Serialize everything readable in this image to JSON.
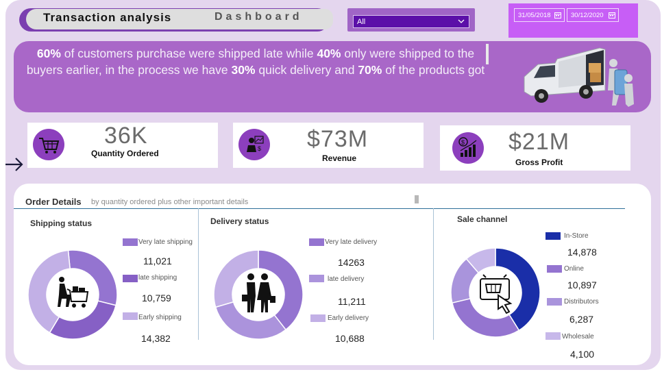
{
  "header": {
    "title_left": "Transaction analysis",
    "title_right": "Dashboard",
    "filter_value": "All",
    "date_start": "31/05/2018",
    "date_end": "30/12/2020"
  },
  "banner": {
    "p1": "60%",
    "t1": " of customers purchase were shipped late while ",
    "p2": "40%",
    "t2": " only were shipped to the buyers earlier, in the process we have ",
    "p3": "30%",
    "t3": " quick delivery and ",
    "p4": "70%",
    "t4": " of the products got"
  },
  "kpis": [
    {
      "value": "36K",
      "label": "Quantity Ordered",
      "icon": "shopping-cart-icon"
    },
    {
      "value": "$73M",
      "label": "Revenue",
      "icon": "analyst-icon"
    },
    {
      "value": "$21M",
      "label": "Gross Profit",
      "icon": "profit-chart-icon"
    }
  ],
  "details": {
    "title": "Order Details",
    "subtitle": "by quantity ordered plus other important details"
  },
  "shipping": {
    "title": "Shipping status",
    "items": [
      {
        "label": "Very late shipping",
        "value": "11,021"
      },
      {
        "label": "late shipping",
        "value": "10,759"
      },
      {
        "label": "Early shipping",
        "value": "14,382"
      }
    ]
  },
  "delivery": {
    "title": "Delivery status",
    "items": [
      {
        "label": "Very late delivery",
        "value": "14263"
      },
      {
        "label": "late delivery",
        "value": "11,211"
      },
      {
        "label": "Early delivery",
        "value": "10,688"
      }
    ]
  },
  "channel": {
    "title": "Sale channel",
    "items": [
      {
        "label": "In-Store",
        "value": "14,878"
      },
      {
        "label": "Online",
        "value": "10,897"
      },
      {
        "label": "Distributors",
        "value": "6,287"
      },
      {
        "label": "Wholesale",
        "value": "4,100"
      }
    ]
  },
  "colors": {
    "shipping": [
      "#9474d0",
      "#8660c5",
      "#c2b0e6"
    ],
    "delivery": [
      "#9474d0",
      "#ab93dc",
      "#c2b0e6"
    ],
    "channel": [
      "#1a2ea8",
      "#9474d0",
      "#a994dc",
      "#c7b8ea"
    ],
    "accent": "#8c3fbd"
  },
  "chart_data": [
    {
      "type": "pie",
      "title": "Shipping status",
      "categories": [
        "Very late shipping",
        "late shipping",
        "Early shipping"
      ],
      "values": [
        11021,
        10759,
        14382
      ]
    },
    {
      "type": "pie",
      "title": "Delivery status",
      "categories": [
        "Very late delivery",
        "late delivery",
        "Early delivery"
      ],
      "values": [
        14263,
        11211,
        10688
      ]
    },
    {
      "type": "pie",
      "title": "Sale channel",
      "categories": [
        "In-Store",
        "Online",
        "Distributors",
        "Wholesale"
      ],
      "values": [
        14878,
        10897,
        6287,
        4100
      ]
    }
  ]
}
